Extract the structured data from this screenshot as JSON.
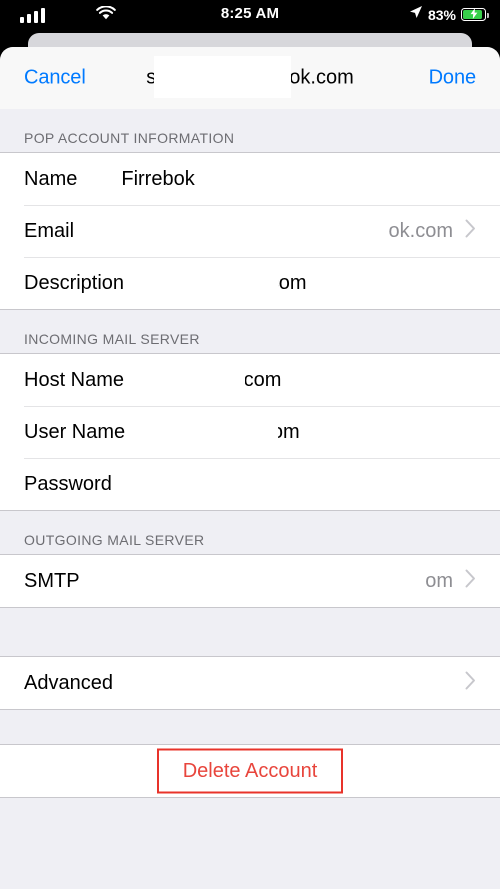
{
  "status_bar": {
    "time": "8:25 AM",
    "battery_percent": "83%",
    "signal_icon": "cellular-signal-icon",
    "wifi_icon": "wifi-icon",
    "location_icon": "location-arrow-icon",
    "battery_icon": "battery-charging-icon",
    "battery_fill_color": "#37d04a",
    "battery_level": 83,
    "charging": true
  },
  "navbar": {
    "cancel_label": "Cancel",
    "done_label": "Done",
    "title_prefix": "s",
    "title_suffix": "ok.com",
    "accent_color": "#007aff"
  },
  "sections": [
    {
      "header": "POP ACCOUNT INFORMATION",
      "rows": [
        {
          "label": "Name",
          "value": "Firrebok",
          "value_muted": false,
          "chevron": false,
          "redacted": false
        },
        {
          "label": "Email",
          "value": "ok.com",
          "value_muted": true,
          "chevron": true,
          "redacted": true
        },
        {
          "label": "Description",
          "value": "ok.com",
          "value_muted": false,
          "chevron": false,
          "redacted": true
        }
      ]
    },
    {
      "header": "INCOMING MAIL SERVER",
      "rows": [
        {
          "label": "Host Name",
          "value": "k.com",
          "value_muted": false,
          "chevron": false,
          "redacted": true
        },
        {
          "label": "User Name",
          "value": "ok.com",
          "value_muted": false,
          "chevron": false,
          "redacted": true
        },
        {
          "label": "Password",
          "value": "",
          "value_muted": false,
          "chevron": false,
          "redacted": false
        }
      ]
    },
    {
      "header": "OUTGOING MAIL SERVER",
      "rows": [
        {
          "label": "SMTP",
          "value": "om",
          "value_muted": true,
          "chevron": true,
          "redacted": true
        }
      ]
    },
    {
      "header": "",
      "rows": [
        {
          "label": "Advanced",
          "value": "",
          "value_muted": false,
          "chevron": true,
          "redacted": false
        }
      ]
    }
  ],
  "delete_account": {
    "label": "Delete Account",
    "text_color": "#e8453c",
    "annotation_color": "#e8332a"
  },
  "icons": {
    "chevron": "chevron-right-icon"
  }
}
